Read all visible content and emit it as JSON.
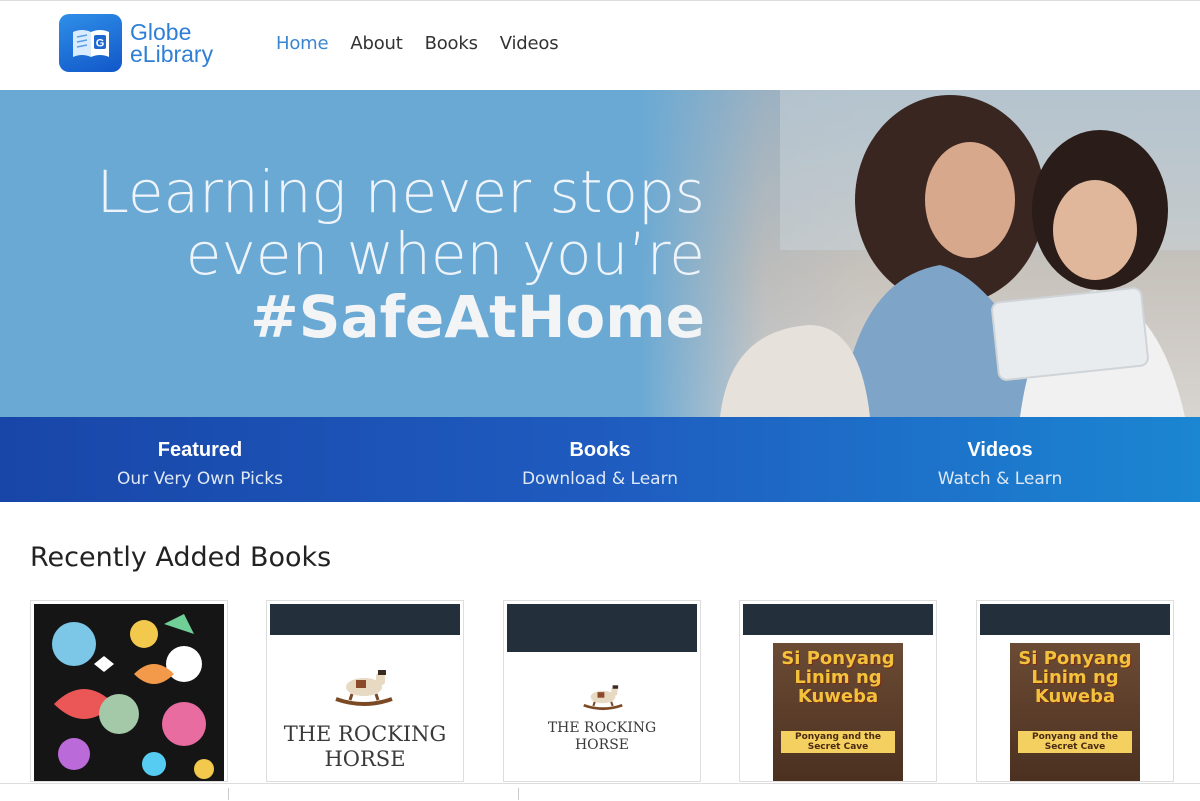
{
  "header": {
    "logo_line1": "Globe",
    "logo_line2": "eLibrary",
    "logo_letter": "G",
    "nav": [
      "Home",
      "About",
      "Books",
      "Videos"
    ],
    "active_nav": "Home"
  },
  "hero": {
    "line1": "Learning never stops",
    "line2": "even when you’re",
    "line3": "#SafeAtHome"
  },
  "categories": [
    {
      "title": "Featured",
      "subtitle": "Our Very Own Picks"
    },
    {
      "title": "Books",
      "subtitle": "Download & Learn"
    },
    {
      "title": "Videos",
      "subtitle": "Watch & Learn"
    }
  ],
  "recent": {
    "heading": "Recently Added Books",
    "books": [
      {
        "cover": "illustrated-collage"
      },
      {
        "cover_title_1": "THE ROCKING",
        "cover_title_2": "HORSE"
      },
      {
        "cover_title_1": "THE ROCKING",
        "cover_title_2": "HORSE"
      },
      {
        "cover_title_1": "Si Ponyang",
        "cover_title_2": "Linim ng",
        "cover_title_3": "Kuweba",
        "cover_sub": "Ponyang and the Secret Cave"
      },
      {
        "cover_title_1": "Si Ponyang",
        "cover_title_2": "Linim ng",
        "cover_title_3": "Kuweba",
        "cover_sub": "Ponyang and the Secret Cave"
      }
    ]
  },
  "colors": {
    "brand_blue": "#2f7fd6",
    "hero_bg": "#6aa9d4",
    "band_start": "#1846a8",
    "band_end": "#1b86d2"
  }
}
